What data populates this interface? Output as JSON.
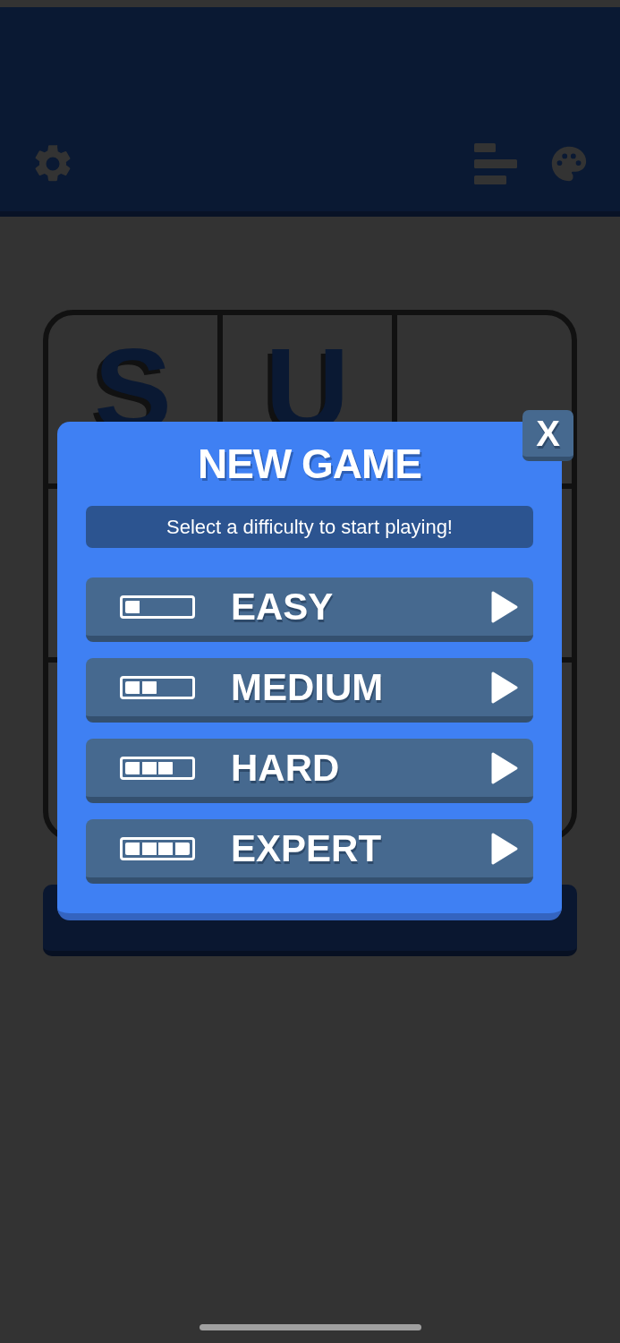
{
  "board": {
    "cells": [
      "S",
      "U"
    ]
  },
  "dialog": {
    "title": "NEW GAME",
    "close_label": "X",
    "subtitle": "Select a difficulty to start playing!",
    "options": [
      {
        "label": "EASY",
        "level": 0.25
      },
      {
        "label": "MEDIUM",
        "level": 0.5
      },
      {
        "label": "HARD",
        "level": 0.75
      },
      {
        "label": "EXPERT",
        "level": 1
      }
    ]
  }
}
